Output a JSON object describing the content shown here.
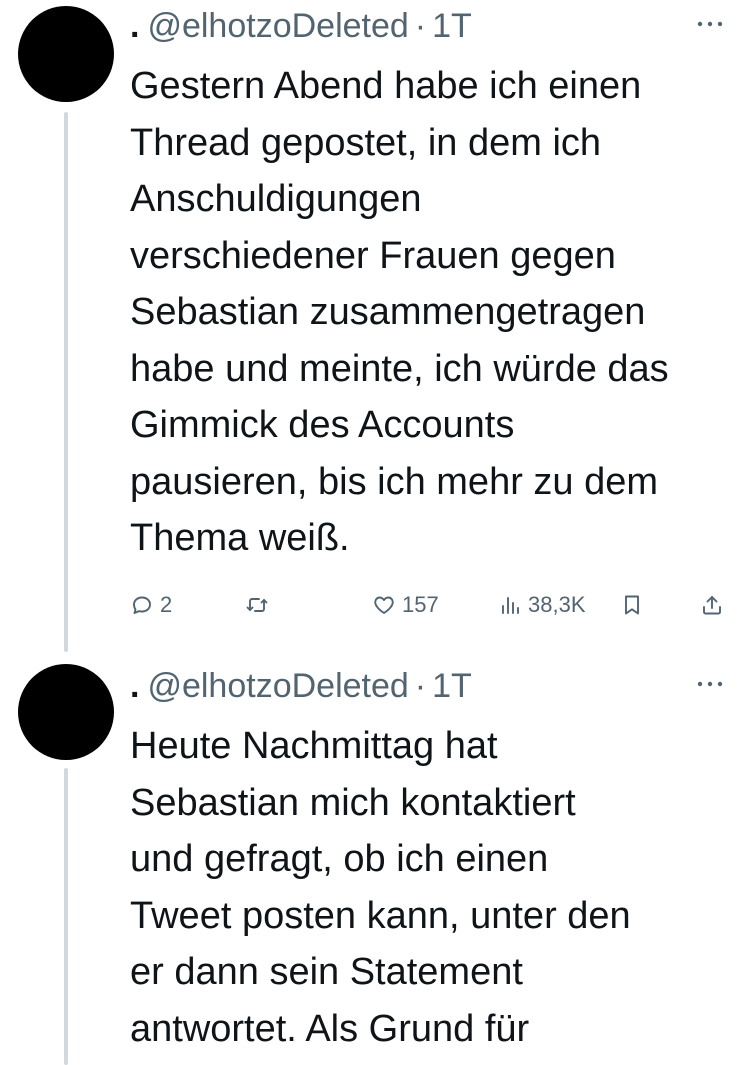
{
  "tweets": [
    {
      "display_name": ".",
      "handle": "@elhotzoDeleted",
      "separator": "·",
      "time": "1T",
      "lines": [
        "Gestern Abend habe ich einen",
        "Thread gepostet, in dem ich",
        "Anschuldigungen",
        "verschiedener Frauen gegen",
        "Sebastian zusammengetragen",
        "habe und meinte, ich würde das",
        "Gimmick des Accounts",
        "pausieren, bis ich mehr zu dem",
        "Thema weiß."
      ],
      "stats": {
        "replies": "2",
        "retweets": "",
        "likes": "157",
        "views": "38,3K"
      }
    },
    {
      "display_name": ".",
      "handle": "@elhotzoDeleted",
      "separator": "·",
      "time": "1T",
      "lines": [
        "Heute Nachmittag hat",
        "Sebastian mich kontaktiert",
        "und gefragt, ob ich einen",
        "Tweet posten kann, unter den",
        "er dann sein Statement",
        "antwortet. Als Grund für"
      ]
    }
  ],
  "icons": {
    "more": "more-horizontal-icon",
    "reply": "reply-bubble-icon",
    "retweet": "retweet-icon",
    "like": "heart-icon",
    "views": "views-bar-chart-icon",
    "bookmark": "bookmark-icon",
    "share": "share-icon"
  },
  "colors": {
    "text": "#0f1419",
    "secondary": "#536471",
    "thread_line": "#cfd9de",
    "avatar": "#000000"
  }
}
